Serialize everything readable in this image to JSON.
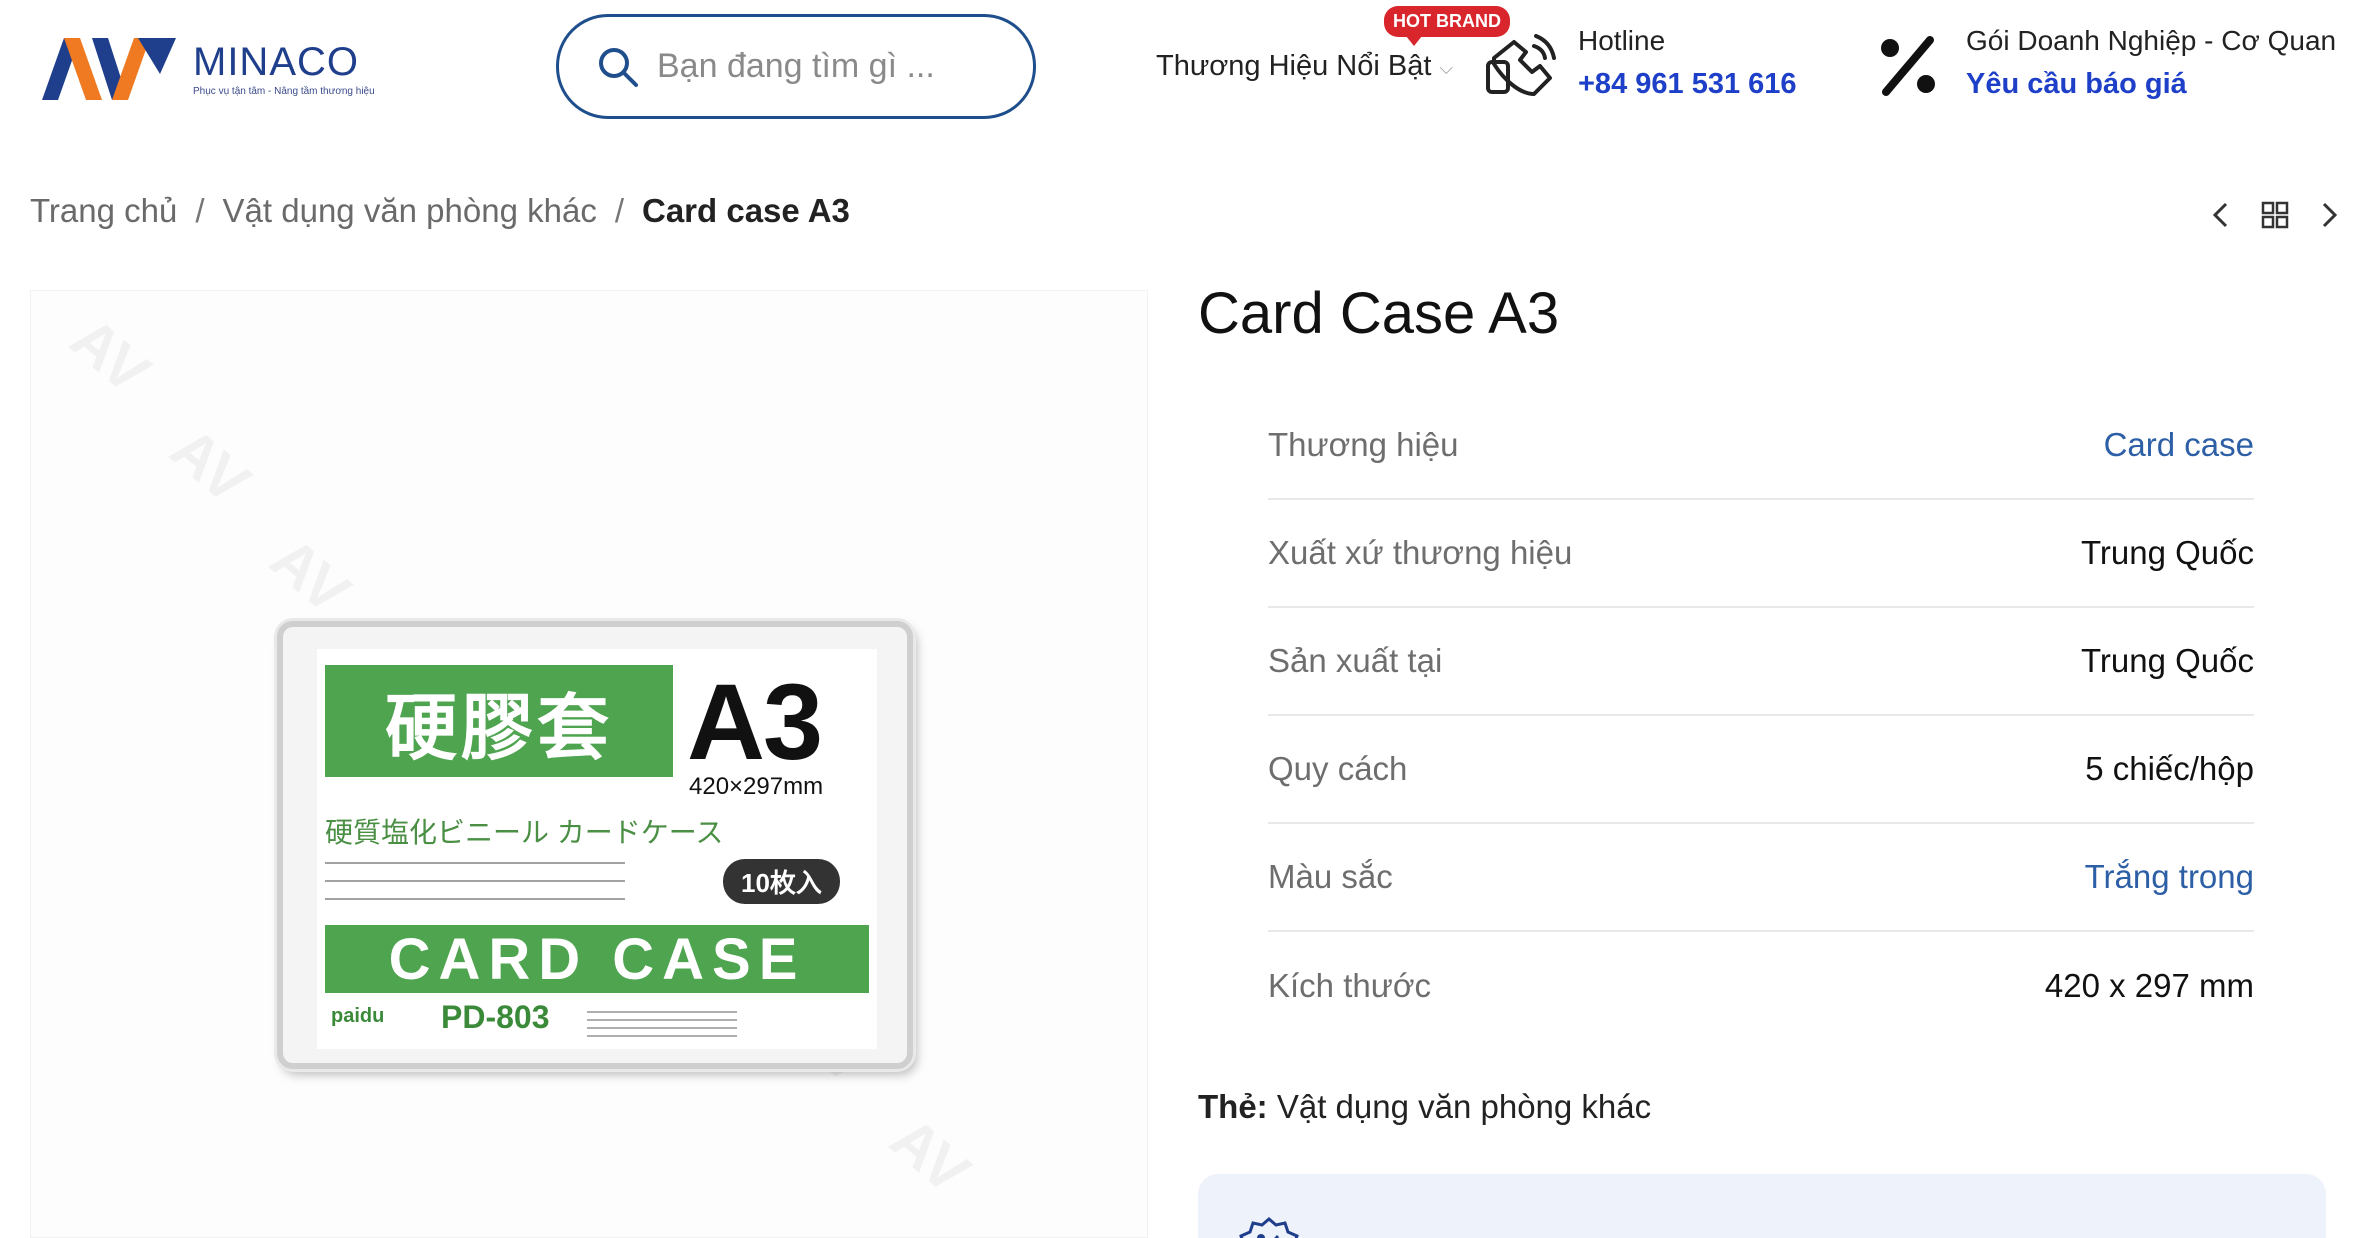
{
  "header": {
    "logo": {
      "name": "MINACO",
      "tagline": "Phục vụ tận tâm - Nâng tầm thương hiệu"
    },
    "search": {
      "placeholder": "Bạn đang tìm gì ..."
    },
    "brand_nav": {
      "label": "Thương Hiệu Nổi Bật",
      "badge": "HOT BRAND"
    },
    "hotline": {
      "title": "Hotline",
      "phone": "+84 961 531 616"
    },
    "business": {
      "title": "Gói Doanh Nghiệp - Cơ Quan",
      "link": "Yêu cầu báo giá"
    }
  },
  "breadcrumb": {
    "items": [
      "Trang chủ",
      "Vật dụng văn phòng khác"
    ],
    "current": "Card case A3",
    "separator": "/"
  },
  "product": {
    "title": "Card Case A3",
    "image": {
      "big_label": "A3",
      "cn_title": "硬膠套",
      "size_text": "420×297mm",
      "jp_text": "硬質塩化ビニール カードケース",
      "count_badge": "10枚入",
      "bar_text": "CARD CASE",
      "maker": "paidu",
      "model": "PD-803",
      "watermark": "AV"
    },
    "attributes": [
      {
        "key": "Thương hiệu",
        "value": "Card case",
        "is_link": true
      },
      {
        "key": "Xuất xứ thương hiệu",
        "value": "Trung Quốc",
        "is_link": false
      },
      {
        "key": "Sản xuất tại",
        "value": "Trung Quốc",
        "is_link": false
      },
      {
        "key": "Quy cách",
        "value": "5 chiếc/hộp",
        "is_link": false
      },
      {
        "key": "Màu sắc",
        "value": "Trắng trong",
        "is_link": true
      },
      {
        "key": "Kích thước",
        "value": "420 x 297 mm",
        "is_link": false
      }
    ],
    "tags": {
      "label": "Thẻ:",
      "value": "Vật dụng văn phòng khác"
    }
  },
  "colors": {
    "brand_blue": "#1f3f8c",
    "brand_orange": "#f07a22",
    "link_blue": "#1e40c8",
    "attr_link": "#2d5fa6",
    "hot_red": "#d8262c",
    "card_green": "#4ea44f"
  },
  "icons": {
    "search": "search-icon",
    "hotline": "phone-hand-icon",
    "business": "percent-icon",
    "prev": "chevron-left-icon",
    "grid": "grid-icon",
    "next": "chevron-right-icon",
    "promo": "discount-badge-icon"
  }
}
